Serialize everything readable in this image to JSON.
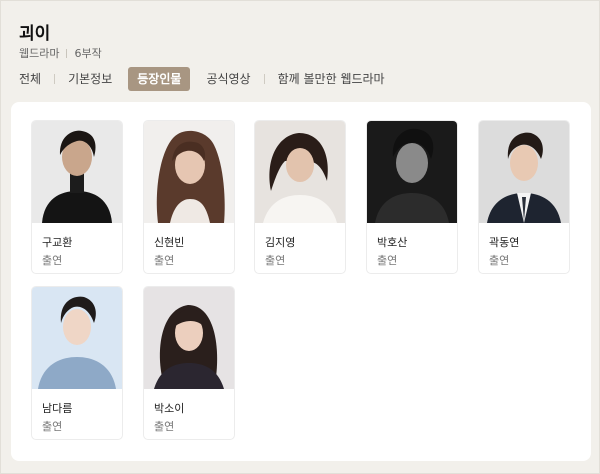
{
  "title": "괴이",
  "meta": {
    "genre": "웹드라마",
    "episodes": "6부작"
  },
  "tabs": [
    {
      "label": "전체"
    },
    {
      "label": "기본정보"
    },
    {
      "label": "등장인물",
      "active": true
    },
    {
      "label": "공식영상"
    },
    {
      "label": "함께 볼만한 웹드라마"
    }
  ],
  "cast": [
    {
      "name": "구교환",
      "role": "출연",
      "photo": "portrait-man-black-turtleneck"
    },
    {
      "name": "신현빈",
      "role": "출연",
      "photo": "portrait-woman-long-hair"
    },
    {
      "name": "김지영",
      "role": "출연",
      "photo": "portrait-woman-white-top"
    },
    {
      "name": "박호산",
      "role": "출연",
      "photo": "portrait-man-black-and-white"
    },
    {
      "name": "곽동연",
      "role": "출연",
      "photo": "portrait-man-suit"
    },
    {
      "name": "남다름",
      "role": "출연",
      "photo": "portrait-boy-blue-sweater"
    },
    {
      "name": "박소이",
      "role": "출연",
      "photo": "portrait-girl-dark-top"
    }
  ],
  "colors": {
    "active_tab": "#a89682",
    "page_bg": "#f2f0eb"
  }
}
